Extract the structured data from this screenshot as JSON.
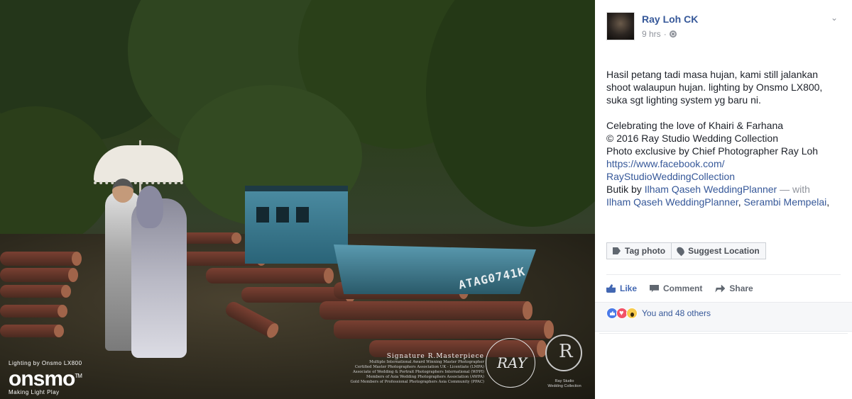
{
  "photo": {
    "boat_registration": "ATAG0741K",
    "watermark_onsmo": {
      "top_line": "Lighting by Onsmo LX800",
      "brand": "onsmo",
      "tm": "TM",
      "tagline": "Making Light Play"
    },
    "signature": {
      "title": "Signature R.Masterpiece",
      "lines": [
        "Multiple International Award Winning Master Photographer",
        "Certified Master Photographers Association UK - Licentiate (LMPA)",
        "Associate of Wedding & Portrait Photographers International (WPPI)",
        "Members of Asia Wedding Photographers Association (AWPA)",
        "Gold Members of Professional Photographers Asia Community (PPAC)"
      ],
      "scribble": "RAY"
    },
    "crest": {
      "letter": "R",
      "text_line1": "Ray Studio",
      "text_line2": "Wedding Collection"
    }
  },
  "post": {
    "author": "Ray Loh CK",
    "time": "9 hrs",
    "separator": "·",
    "caption": {
      "para1_lines": [
        "Hasil petang tadi masa hujan, kami still jalankan",
        "shoot walaupun hujan. lighting by Onsmo LX800,",
        "suka sgt lighting system yg baru ni."
      ],
      "celebrating": "Celebrating the love of Khairi & Farhana",
      "copyright": "© 2016 Ray Studio Wedding Collection",
      "exclusive": "Photo exclusive by Chief Photographer Ray Loh",
      "link_line1": "https://www.facebook.com/",
      "link_line2": "RayStudioWeddingCollection",
      "butik_prefix": "Butik by ",
      "butik_link": "Ilham Qaseh WeddingPlanner",
      "with_text": " — with",
      "tagged1": "Ilham Qaseh WeddingPlanner",
      "comma1": ", ",
      "tagged2": "Serambi Mempelai",
      "comma2": ","
    },
    "tag_photo": "Tag photo",
    "suggest_location": "Suggest Location",
    "actions": {
      "like": "Like",
      "comment": "Comment",
      "share": "Share"
    },
    "reactions_text": "You and 48 others"
  },
  "colors": {
    "link": "#365899",
    "accent": "#4267b2",
    "muted": "#90949c"
  }
}
